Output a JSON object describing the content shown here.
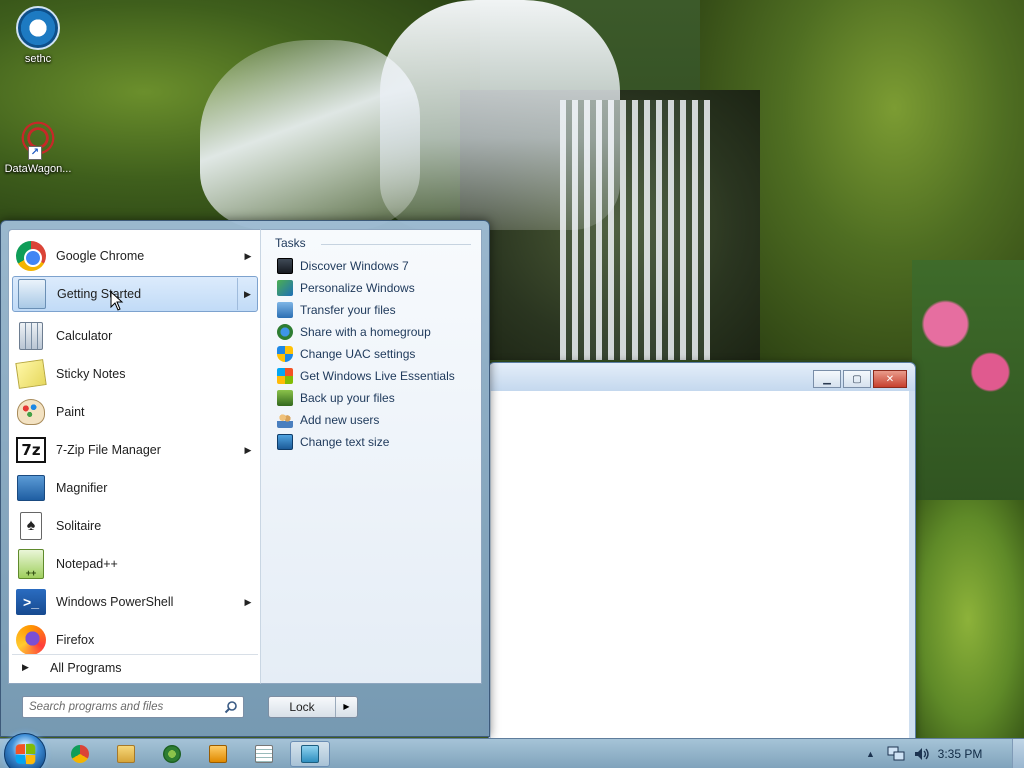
{
  "desktop": {
    "icons": [
      {
        "label": "sethc"
      },
      {
        "label": "DataWagon..."
      }
    ]
  },
  "start_menu": {
    "programs": [
      {
        "label": "Google Chrome",
        "icon": "chrome-icon",
        "has_arrow": true
      },
      {
        "label": "Getting Started",
        "icon": "getting-started-icon",
        "has_arrow": true,
        "selected": true
      },
      {
        "label": "Calculator",
        "icon": "calculator-icon",
        "has_arrow": false
      },
      {
        "label": "Sticky Notes",
        "icon": "sticky-notes-icon",
        "has_arrow": false
      },
      {
        "label": "Paint",
        "icon": "paint-icon",
        "has_arrow": false
      },
      {
        "label": "7-Zip File Manager",
        "icon": "7zip-icon",
        "has_arrow": true
      },
      {
        "label": "Magnifier",
        "icon": "magnifier-icon",
        "has_arrow": false
      },
      {
        "label": "Solitaire",
        "icon": "solitaire-icon",
        "has_arrow": false
      },
      {
        "label": "Notepad++",
        "icon": "notepadpp-icon",
        "has_arrow": false
      },
      {
        "label": "Windows PowerShell",
        "icon": "powershell-icon",
        "has_arrow": true
      },
      {
        "label": "Firefox",
        "icon": "firefox-icon",
        "has_arrow": false
      }
    ],
    "all_programs_label": "All Programs",
    "tasks_title": "Tasks",
    "tasks": [
      {
        "label": "Discover Windows 7"
      },
      {
        "label": "Personalize Windows"
      },
      {
        "label": "Transfer your files"
      },
      {
        "label": "Share with a homegroup"
      },
      {
        "label": "Change UAC settings"
      },
      {
        "label": "Get Windows Live Essentials"
      },
      {
        "label": "Back up your files"
      },
      {
        "label": "Add new users"
      },
      {
        "label": "Change text size"
      }
    ],
    "search_placeholder": "Search programs and files",
    "lock_label": "Lock"
  },
  "taskbar": {
    "clock": "3:35 PM",
    "pinned": [
      "chrome",
      "explorer",
      "media-center",
      "media-player",
      "notepad",
      "getting-started"
    ]
  }
}
